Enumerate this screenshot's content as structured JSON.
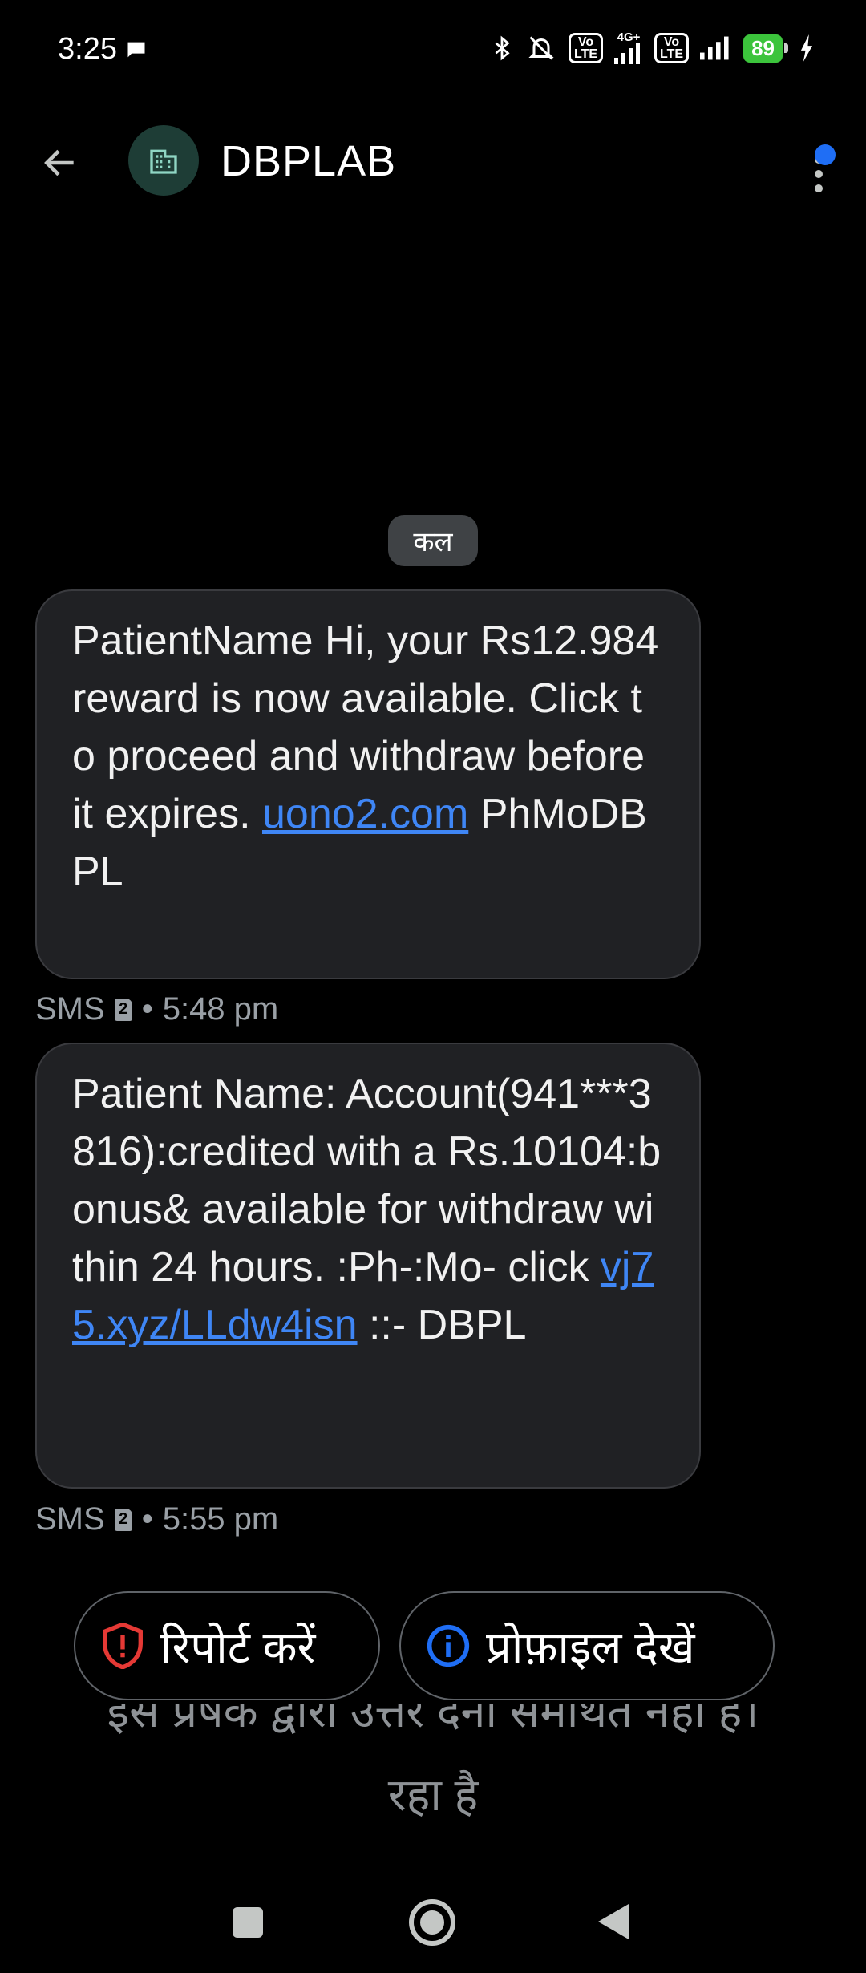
{
  "status_bar": {
    "time": "3:25",
    "network_label": "4G+",
    "volte_label": "Vo LTE",
    "battery": "89"
  },
  "app_bar": {
    "contact_name": "DBPLAB"
  },
  "conversation": {
    "date_chip": "कल",
    "messages": [
      {
        "text_before": "PatientName Hi, your Rs12.984 reward is now available. Click to proceed and withdraw before it expires. ",
        "link": "uono2.com",
        "text_after": " PhMoDBPL",
        "type": "SMS",
        "sim": "2",
        "time": "5:48 pm"
      },
      {
        "text_before": "Patient Name: Account(941***3816):credited with a Rs.10104:bonus& available for withdraw within 24 hours. :Ph-:Mo- click ",
        "link": "vj75.xyz/LLdw4isn",
        "text_after": " ::- DBPL",
        "type": "SMS",
        "sim": "2",
        "time": "5:55 pm"
      }
    ]
  },
  "actions": {
    "report_label": "रिपोर्ट करें",
    "profile_label": "प्रोफ़ाइल देखें"
  },
  "footer_notice": {
    "line1": "इस प्रेषक द्वारा उत्तर देना समर्थित नहीं है।",
    "line2": "रहा है"
  },
  "colors": {
    "background": "#000000",
    "bubble": "#202124",
    "link": "#3f86f5",
    "report_icon": "#e53935",
    "info_icon": "#1f6ef5",
    "battery": "#3cc43c"
  }
}
